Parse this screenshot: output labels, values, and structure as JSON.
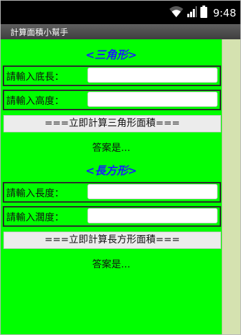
{
  "status_bar": {
    "time": "9:48",
    "icons": [
      "wifi-icon",
      "signal-icon",
      "battery-icon"
    ]
  },
  "app": {
    "title": "計算面積小幫手"
  },
  "triangle": {
    "heading": "<三角形>",
    "base_label": "請輸入底長：",
    "base_value": "",
    "height_label": "請輸入高度：",
    "height_value": "",
    "button_label": "===立即計算三角形面積===",
    "answer": "答案是..."
  },
  "rectangle": {
    "heading": "<長方形>",
    "length_label": "請輸入長度：",
    "length_value": "",
    "width_label": "請輸入濶度：",
    "width_value": "",
    "button_label": "===立即計算長方形面積===",
    "answer": "答案是..."
  },
  "colors": {
    "background": "#00ff00",
    "heading": "#1a1aff",
    "statusbar": "#000000"
  }
}
